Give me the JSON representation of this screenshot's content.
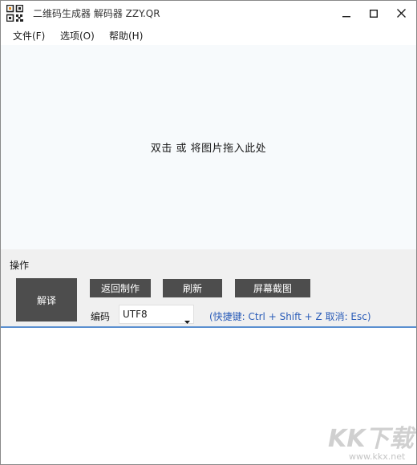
{
  "window": {
    "title": "二维码生成器 解码器 ZZY.QR"
  },
  "menu": {
    "items": [
      {
        "label": "文件(F)"
      },
      {
        "label": "选项(O)"
      },
      {
        "label": "帮助(H)"
      }
    ]
  },
  "drop_area": {
    "hint": "双击 或 将图片拖入此处"
  },
  "operations": {
    "label": "操作",
    "decode_label": "解译",
    "back_label": "返回制作",
    "refresh_label": "刷新",
    "screenshot_label": "屏幕截图",
    "encoding_label": "编码",
    "encoding_value": "UTF8",
    "shortcut_hint": "(快捷键: Ctrl + Shift + Z  取消: Esc)"
  },
  "watermark": {
    "text": "KK下载",
    "url": "www.kkx.net"
  },
  "colors": {
    "button_dark": "#4d4d4d",
    "hint_blue": "#2a5cb8",
    "separator": "#5a8fd0",
    "drop_bg": "#f7fafc",
    "panel_bg": "#f0f0f0"
  },
  "icons": {
    "app": "qr-code-icon",
    "minimize": "minimize-icon",
    "maximize": "maximize-icon",
    "close": "close-icon",
    "dropdown": "chevron-down-icon"
  }
}
